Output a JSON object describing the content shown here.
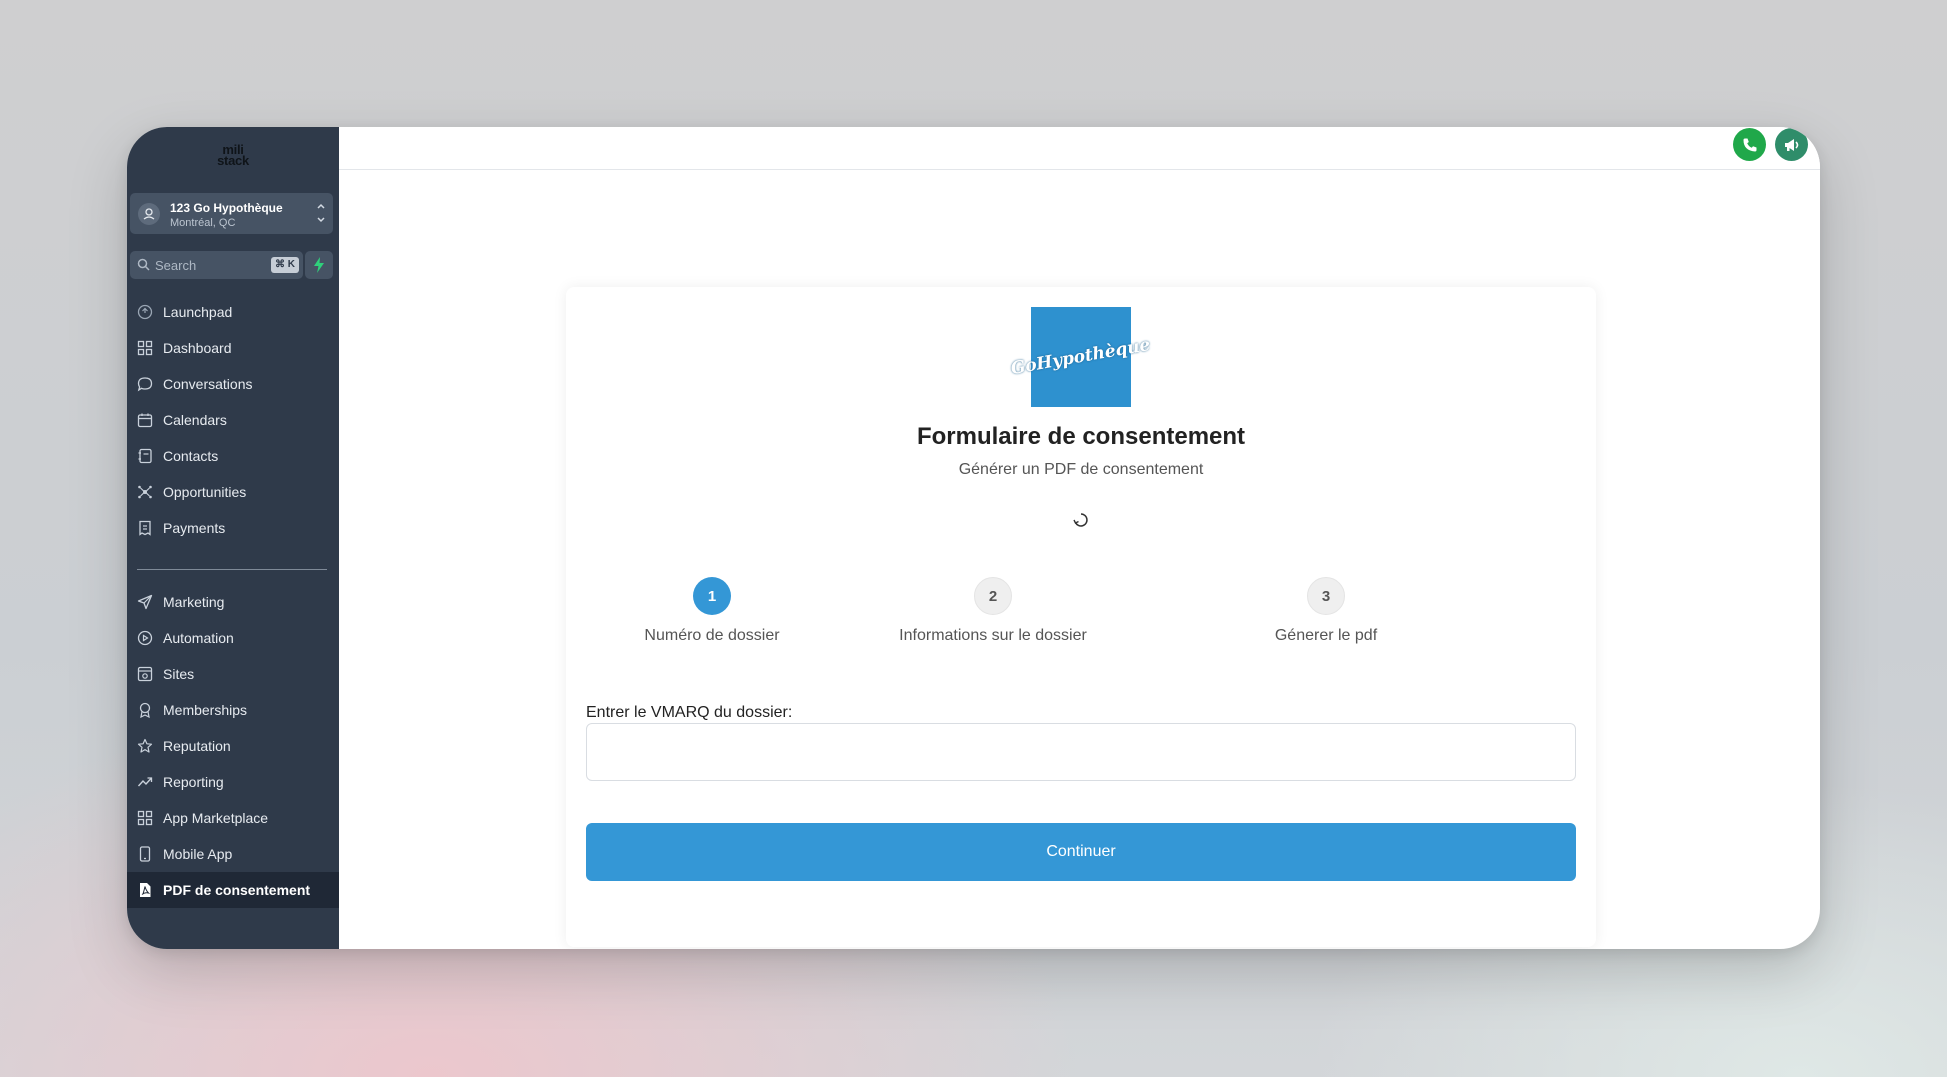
{
  "sidebar": {
    "logo_line1": "mili",
    "logo_line2": "stack",
    "account": {
      "name": "123 Go Hypothèque",
      "location": "Montréal, QC"
    },
    "search": {
      "label": "Search",
      "shortcut": "⌘ K"
    },
    "nav_primary": [
      {
        "label": "Launchpad",
        "icon": "launchpad-icon"
      },
      {
        "label": "Dashboard",
        "icon": "grid-icon"
      },
      {
        "label": "Conversations",
        "icon": "chat-icon"
      },
      {
        "label": "Calendars",
        "icon": "calendar-icon"
      },
      {
        "label": "Contacts",
        "icon": "contacts-icon"
      },
      {
        "label": "Opportunities",
        "icon": "network-icon"
      },
      {
        "label": "Payments",
        "icon": "receipt-icon"
      }
    ],
    "nav_secondary": [
      {
        "label": "Marketing",
        "icon": "send-icon"
      },
      {
        "label": "Automation",
        "icon": "automation-icon"
      },
      {
        "label": "Sites",
        "icon": "sites-icon"
      },
      {
        "label": "Memberships",
        "icon": "award-icon"
      },
      {
        "label": "Reputation",
        "icon": "star-icon"
      },
      {
        "label": "Reporting",
        "icon": "trend-icon"
      },
      {
        "label": "App Marketplace",
        "icon": "grid-icon"
      },
      {
        "label": "Mobile App",
        "icon": "mobile-icon"
      },
      {
        "label": "PDF de consentement",
        "icon": "pdf-icon",
        "active": true
      }
    ]
  },
  "topbar": {
    "icons": [
      "phone-icon",
      "megaphone-icon",
      "bell-icon",
      "help-icon",
      "avatar"
    ],
    "help_label": "?"
  },
  "form": {
    "logo_text": "GoHypothèque",
    "title": "Formulaire de consentement",
    "subtitle": "Générer un PDF de consentement",
    "steps": [
      {
        "number": "1",
        "label": "Numéro de dossier",
        "active": true
      },
      {
        "number": "2",
        "label": "Informations sur le dossier",
        "active": false
      },
      {
        "number": "3",
        "label": "Génerer le pdf",
        "active": false
      }
    ],
    "field_label": "Entrer le VMARQ du dossier:",
    "field_value": "",
    "field_placeholder": "",
    "continue_label": "Continuer"
  },
  "colors": {
    "sidebar_bg": "#2f3a4a",
    "accent": "#3497d6",
    "phone": "#20a84a",
    "megaphone": "#2f8d6a",
    "bell": "#f26b1d",
    "help": "#1d86f0"
  }
}
